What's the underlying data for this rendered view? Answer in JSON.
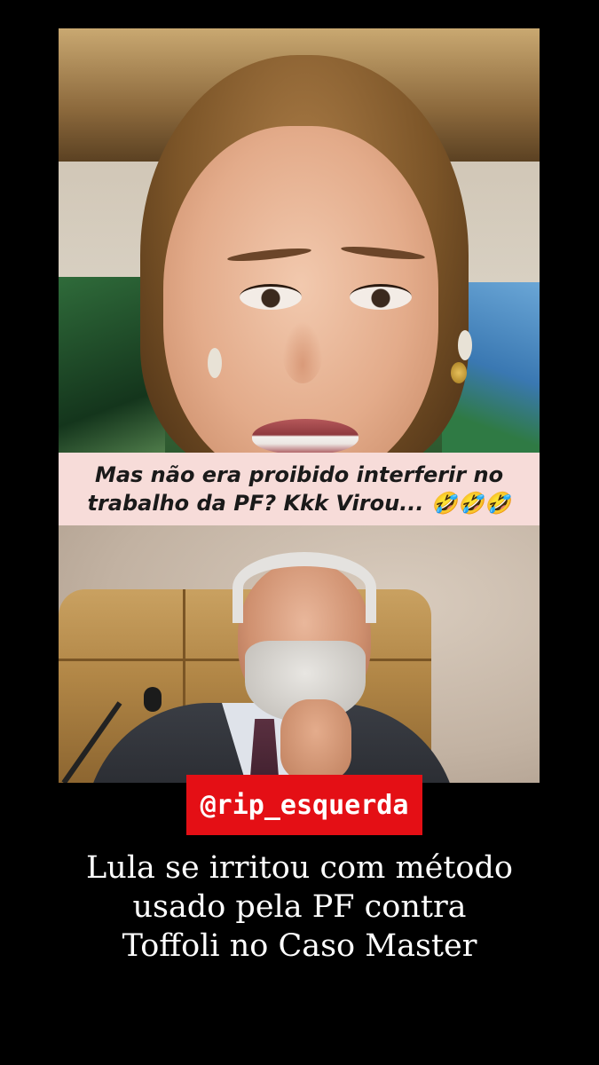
{
  "caption": {
    "line1": "Mas não era proibido interferir no",
    "line2": "trabalho da PF? Kkk Virou... 🤣🤣🤣"
  },
  "handle": "@rip_esquerda",
  "headline": {
    "line1": "Lula se irritou com método",
    "line2": "usado pela PF contra",
    "line3": "Toffoli no Caso Master"
  },
  "colors": {
    "background": "#000000",
    "caption_bg": "#f7dcd9",
    "handle_bg": "#e40f15",
    "headline_text": "#ffffff"
  }
}
